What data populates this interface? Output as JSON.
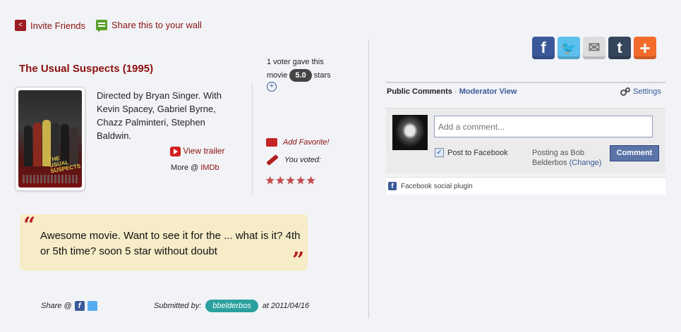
{
  "top_actions": {
    "invite_label": "Invite Friends",
    "wall_label": "Share this to your wall"
  },
  "movie": {
    "title": "The Usual Suspects (1995)",
    "description": "Directed by Bryan Singer. With Kevin Spacey, Gabriel Byrne, Chazz Palminteri, Stephen Baldwin.",
    "trailer_label": "View trailer",
    "more_prefix": "More @",
    "imdb_label": "IMDb",
    "poster_title": "THE USUAL SUSPECTS"
  },
  "rating": {
    "voters_text": "1 voter gave this",
    "movie_label": "movie",
    "score": "5.0",
    "stars_label": "stars",
    "add_favorite": "Add Favorite!",
    "you_voted": "You voted:",
    "user_stars": 5
  },
  "quote": {
    "open_mark": "“",
    "close_mark": "”",
    "text": "Awesome movie. Want to see it for the ... what is it? 4th or 5th time? soon 5 star without doubt"
  },
  "share_row": {
    "share_label": "Share @",
    "submitted_by": "Submitted by:",
    "username": "bbelderbos",
    "date_text": "at 2011/04/16"
  },
  "social_buttons": [
    {
      "name": "facebook",
      "glyph": "f",
      "color": "#3b5998"
    },
    {
      "name": "twitter",
      "glyph": "t",
      "color": "#5dc0ec"
    },
    {
      "name": "email",
      "glyph": "✉",
      "color": "#dcdcdc"
    },
    {
      "name": "tumblr",
      "glyph": "t",
      "color": "#35465c"
    },
    {
      "name": "addthis",
      "glyph": "+",
      "color": "#f36b2b"
    }
  ],
  "comments": {
    "tab_public": "Public Comments",
    "separator": "·",
    "tab_moderator": "Moderator View",
    "settings_label": "Settings",
    "input_placeholder": "Add a comment...",
    "post_to_facebook": "Post to Facebook",
    "posting_as": "Posting as Bob Belderbos",
    "change_label": "(Change)",
    "comment_button": "Comment",
    "plugin_label": "Facebook social plugin"
  }
}
